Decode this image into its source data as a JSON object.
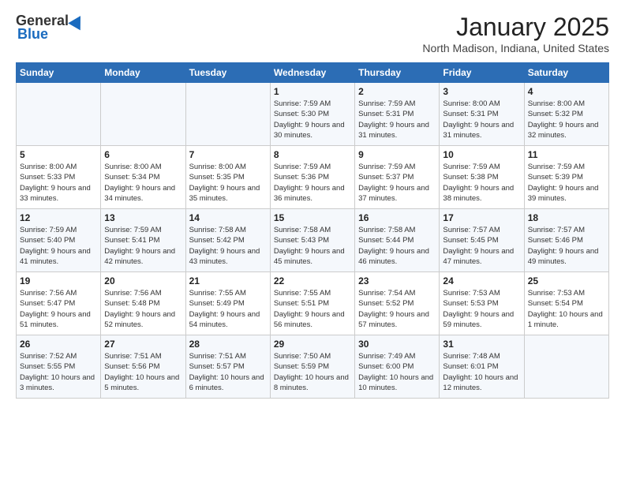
{
  "header": {
    "logo_general": "General",
    "logo_blue": "Blue",
    "month": "January 2025",
    "location": "North Madison, Indiana, United States"
  },
  "days_of_week": [
    "Sunday",
    "Monday",
    "Tuesday",
    "Wednesday",
    "Thursday",
    "Friday",
    "Saturday"
  ],
  "weeks": [
    [
      {
        "day": "",
        "info": ""
      },
      {
        "day": "",
        "info": ""
      },
      {
        "day": "",
        "info": ""
      },
      {
        "day": "1",
        "info": "Sunrise: 7:59 AM\nSunset: 5:30 PM\nDaylight: 9 hours and 30 minutes."
      },
      {
        "day": "2",
        "info": "Sunrise: 7:59 AM\nSunset: 5:31 PM\nDaylight: 9 hours and 31 minutes."
      },
      {
        "day": "3",
        "info": "Sunrise: 8:00 AM\nSunset: 5:31 PM\nDaylight: 9 hours and 31 minutes."
      },
      {
        "day": "4",
        "info": "Sunrise: 8:00 AM\nSunset: 5:32 PM\nDaylight: 9 hours and 32 minutes."
      }
    ],
    [
      {
        "day": "5",
        "info": "Sunrise: 8:00 AM\nSunset: 5:33 PM\nDaylight: 9 hours and 33 minutes."
      },
      {
        "day": "6",
        "info": "Sunrise: 8:00 AM\nSunset: 5:34 PM\nDaylight: 9 hours and 34 minutes."
      },
      {
        "day": "7",
        "info": "Sunrise: 8:00 AM\nSunset: 5:35 PM\nDaylight: 9 hours and 35 minutes."
      },
      {
        "day": "8",
        "info": "Sunrise: 7:59 AM\nSunset: 5:36 PM\nDaylight: 9 hours and 36 minutes."
      },
      {
        "day": "9",
        "info": "Sunrise: 7:59 AM\nSunset: 5:37 PM\nDaylight: 9 hours and 37 minutes."
      },
      {
        "day": "10",
        "info": "Sunrise: 7:59 AM\nSunset: 5:38 PM\nDaylight: 9 hours and 38 minutes."
      },
      {
        "day": "11",
        "info": "Sunrise: 7:59 AM\nSunset: 5:39 PM\nDaylight: 9 hours and 39 minutes."
      }
    ],
    [
      {
        "day": "12",
        "info": "Sunrise: 7:59 AM\nSunset: 5:40 PM\nDaylight: 9 hours and 41 minutes."
      },
      {
        "day": "13",
        "info": "Sunrise: 7:59 AM\nSunset: 5:41 PM\nDaylight: 9 hours and 42 minutes."
      },
      {
        "day": "14",
        "info": "Sunrise: 7:58 AM\nSunset: 5:42 PM\nDaylight: 9 hours and 43 minutes."
      },
      {
        "day": "15",
        "info": "Sunrise: 7:58 AM\nSunset: 5:43 PM\nDaylight: 9 hours and 45 minutes."
      },
      {
        "day": "16",
        "info": "Sunrise: 7:58 AM\nSunset: 5:44 PM\nDaylight: 9 hours and 46 minutes."
      },
      {
        "day": "17",
        "info": "Sunrise: 7:57 AM\nSunset: 5:45 PM\nDaylight: 9 hours and 47 minutes."
      },
      {
        "day": "18",
        "info": "Sunrise: 7:57 AM\nSunset: 5:46 PM\nDaylight: 9 hours and 49 minutes."
      }
    ],
    [
      {
        "day": "19",
        "info": "Sunrise: 7:56 AM\nSunset: 5:47 PM\nDaylight: 9 hours and 51 minutes."
      },
      {
        "day": "20",
        "info": "Sunrise: 7:56 AM\nSunset: 5:48 PM\nDaylight: 9 hours and 52 minutes."
      },
      {
        "day": "21",
        "info": "Sunrise: 7:55 AM\nSunset: 5:49 PM\nDaylight: 9 hours and 54 minutes."
      },
      {
        "day": "22",
        "info": "Sunrise: 7:55 AM\nSunset: 5:51 PM\nDaylight: 9 hours and 56 minutes."
      },
      {
        "day": "23",
        "info": "Sunrise: 7:54 AM\nSunset: 5:52 PM\nDaylight: 9 hours and 57 minutes."
      },
      {
        "day": "24",
        "info": "Sunrise: 7:53 AM\nSunset: 5:53 PM\nDaylight: 9 hours and 59 minutes."
      },
      {
        "day": "25",
        "info": "Sunrise: 7:53 AM\nSunset: 5:54 PM\nDaylight: 10 hours and 1 minute."
      }
    ],
    [
      {
        "day": "26",
        "info": "Sunrise: 7:52 AM\nSunset: 5:55 PM\nDaylight: 10 hours and 3 minutes."
      },
      {
        "day": "27",
        "info": "Sunrise: 7:51 AM\nSunset: 5:56 PM\nDaylight: 10 hours and 5 minutes."
      },
      {
        "day": "28",
        "info": "Sunrise: 7:51 AM\nSunset: 5:57 PM\nDaylight: 10 hours and 6 minutes."
      },
      {
        "day": "29",
        "info": "Sunrise: 7:50 AM\nSunset: 5:59 PM\nDaylight: 10 hours and 8 minutes."
      },
      {
        "day": "30",
        "info": "Sunrise: 7:49 AM\nSunset: 6:00 PM\nDaylight: 10 hours and 10 minutes."
      },
      {
        "day": "31",
        "info": "Sunrise: 7:48 AM\nSunset: 6:01 PM\nDaylight: 10 hours and 12 minutes."
      },
      {
        "day": "",
        "info": ""
      }
    ]
  ]
}
